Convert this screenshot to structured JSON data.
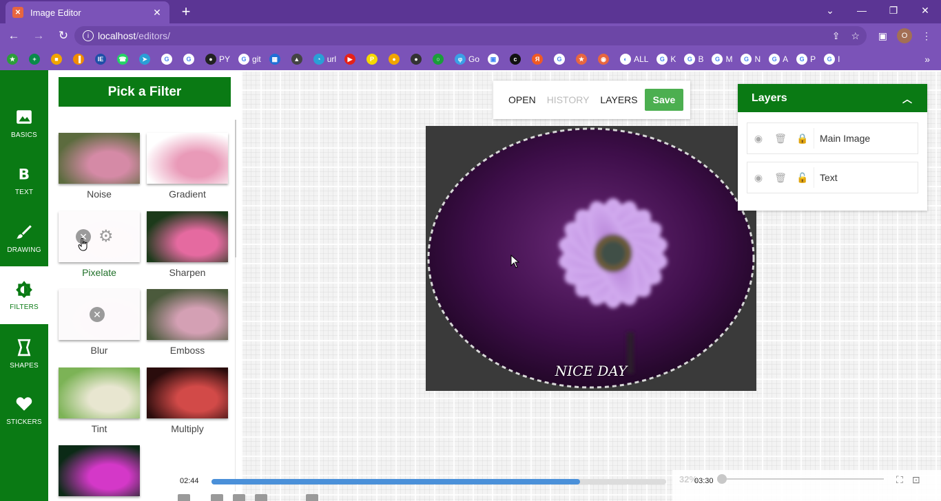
{
  "browser": {
    "tab_title": "Image Editor",
    "tab_favicon_letter": "✕",
    "new_tab": "+",
    "url_host": "localhost",
    "url_path": "/editors/",
    "window_controls": [
      "⌄",
      "—",
      "❐",
      "✕"
    ],
    "profile_initial": "O",
    "bookmarks": [
      {
        "label": "",
        "color": "#2c9e3a",
        "glyph": "★"
      },
      {
        "label": "",
        "color": "#0a8a4a",
        "glyph": "+"
      },
      {
        "label": "",
        "color": "#f0a500",
        "glyph": "■"
      },
      {
        "label": "",
        "color": "#f08c00",
        "glyph": "▐"
      },
      {
        "label": "",
        "color": "#1f4fa8",
        "glyph": "IE"
      },
      {
        "label": "",
        "color": "#25d366",
        "glyph": "☎"
      },
      {
        "label": "",
        "color": "#2a9fd6",
        "glyph": "➤"
      },
      {
        "label": "",
        "color": "#ffffff",
        "glyph": "G"
      },
      {
        "label": "",
        "color": "#ffffff",
        "glyph": "G"
      },
      {
        "label": "PY",
        "color": "#222222",
        "glyph": "●"
      },
      {
        "label": "git",
        "color": "#ffffff",
        "glyph": "G"
      },
      {
        "label": "",
        "color": "#1f6fd6",
        "glyph": "▦"
      },
      {
        "label": "",
        "color": "#444444",
        "glyph": "▲"
      },
      {
        "label": "url",
        "color": "#2a9fd6",
        "glyph": "◔"
      },
      {
        "label": "",
        "color": "#e62117",
        "glyph": "▶"
      },
      {
        "label": "",
        "color": "#f5d800",
        "glyph": "P"
      },
      {
        "label": "",
        "color": "#f0a500",
        "glyph": "●"
      },
      {
        "label": "",
        "color": "#333333",
        "glyph": "●"
      },
      {
        "label": "",
        "color": "#1a9e3a",
        "glyph": "○"
      },
      {
        "label": "Go",
        "color": "#3ba0e6",
        "glyph": "φ"
      },
      {
        "label": "",
        "color": "#ffffff",
        "glyph": "▣"
      },
      {
        "label": "",
        "color": "#111111",
        "glyph": "c"
      },
      {
        "label": "",
        "color": "#f05a24",
        "glyph": "Я"
      },
      {
        "label": "",
        "color": "#ffffff",
        "glyph": "G"
      },
      {
        "label": "",
        "color": "#e8663f",
        "glyph": "★"
      },
      {
        "label": "",
        "color": "#e8663f",
        "glyph": "◉"
      },
      {
        "label": "ALL",
        "color": "#ffffff",
        "glyph": "◐"
      },
      {
        "label": "K",
        "color": "#ffffff",
        "glyph": "G"
      },
      {
        "label": "B",
        "color": "#ffffff",
        "glyph": "G"
      },
      {
        "label": "M",
        "color": "#ffffff",
        "glyph": "G"
      },
      {
        "label": "N",
        "color": "#ffffff",
        "glyph": "G"
      },
      {
        "label": "A",
        "color": "#ffffff",
        "glyph": "G"
      },
      {
        "label": "P",
        "color": "#ffffff",
        "glyph": "G"
      },
      {
        "label": "I",
        "color": "#ffffff",
        "glyph": "G"
      }
    ],
    "bookmarks_more": "»"
  },
  "rail": {
    "items": [
      {
        "label": "BASICS",
        "icon": "image-icon"
      },
      {
        "label": "TEXT",
        "icon": "bold-text-icon"
      },
      {
        "label": "DRAWING",
        "icon": "brush-icon"
      },
      {
        "label": "FILTERS",
        "icon": "brightness-icon"
      },
      {
        "label": "SHAPES",
        "icon": "shape-icon"
      },
      {
        "label": "STICKERS",
        "icon": "heart-icon"
      }
    ],
    "active": "FILTERS"
  },
  "panel": {
    "title": "Pick a Filter",
    "filters": [
      {
        "label": "Noise",
        "state": "normal",
        "colors": [
          "#5c6b3e",
          "#d58aa6"
        ]
      },
      {
        "label": "Gradient",
        "state": "normal",
        "colors": [
          "#ffffff",
          "#e99ab8"
        ]
      },
      {
        "label": "Pixelate",
        "state": "selected",
        "colors": [
          "#f4eef1",
          "#f8e6ee"
        ]
      },
      {
        "label": "Sharpen",
        "state": "normal",
        "colors": [
          "#1c3a1a",
          "#e56aa0"
        ]
      },
      {
        "label": "Blur",
        "state": "disabled",
        "colors": [
          "#efe9ec",
          "#f6e4ec"
        ]
      },
      {
        "label": "Emboss",
        "state": "normal",
        "colors": [
          "#4b5a3c",
          "#d4a0b4"
        ]
      },
      {
        "label": "Tint",
        "state": "normal",
        "colors": [
          "#7cb356",
          "#e8e6d0"
        ]
      },
      {
        "label": "Multiply",
        "state": "normal",
        "colors": [
          "#2a0c0c",
          "#d24a48"
        ]
      },
      {
        "label": "",
        "state": "partial",
        "colors": [
          "#0b2a16",
          "#d438c8"
        ]
      }
    ]
  },
  "toolbar": {
    "open": "OPEN",
    "history": "HISTORY",
    "layers": "LAYERS",
    "save": "Save"
  },
  "canvas": {
    "caption": "NICE DAY",
    "colors": {
      "bg": "#3a3a3a",
      "vignette": "#2a0a30",
      "petal": "#c89be3",
      "center": "#4a5a3a"
    }
  },
  "layers": {
    "title": "Layers",
    "items": [
      {
        "name": "Main Image",
        "locked": true
      },
      {
        "name": "Text",
        "locked": false
      }
    ]
  },
  "video": {
    "current": "02:44",
    "total": "03:30",
    "progress": 0.81,
    "volume_label": "32%",
    "volume": 0.0
  }
}
